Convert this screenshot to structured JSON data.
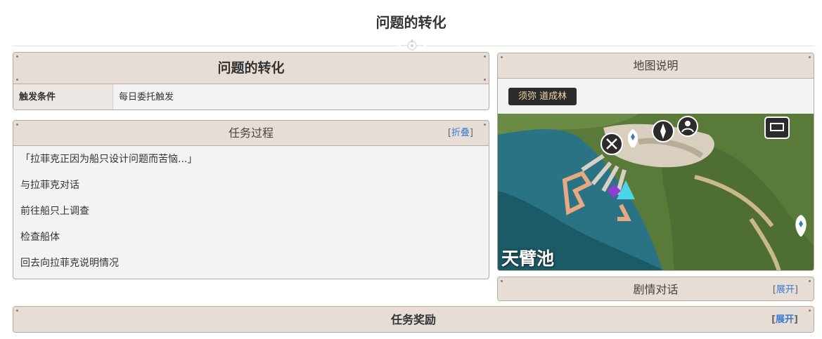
{
  "page": {
    "title": "问题的转化"
  },
  "info_panel": {
    "title": "问题的转化",
    "rows": [
      {
        "key": "触发条件",
        "value": "每日委托触发"
      }
    ]
  },
  "process_panel": {
    "title": "任务过程",
    "toggle": {
      "open": "[",
      "label": "折叠",
      "close": "]"
    },
    "steps": [
      "「拉菲克正因为船只设计问题而苦恼...」",
      "与拉菲克对话",
      "前往船只上调查",
      "检查船体",
      "回去向拉菲克说明情况"
    ]
  },
  "map_panel": {
    "title": "地图说明",
    "tab": "须弥 道成林",
    "map_label": "天臂池",
    "icons": [
      "map-teleport-icon",
      "map-waypoint-icon",
      "map-shop-icon",
      "map-chest-icon"
    ]
  },
  "dialogue_panel": {
    "title": "剧情对话",
    "toggle": {
      "open": "[",
      "label": "展开",
      "close": "]"
    }
  },
  "reward_panel": {
    "title": "任务奖励",
    "toggle": {
      "open": "[",
      "label": "展开",
      "close": "]"
    }
  },
  "colors": {
    "accent_link": "#3a7ad0",
    "panel_header": "#e6ddd6",
    "panel_border": "#b8aa9c",
    "tab_bg": "#2b2b2b",
    "tab_text": "#f1d8a6"
  }
}
